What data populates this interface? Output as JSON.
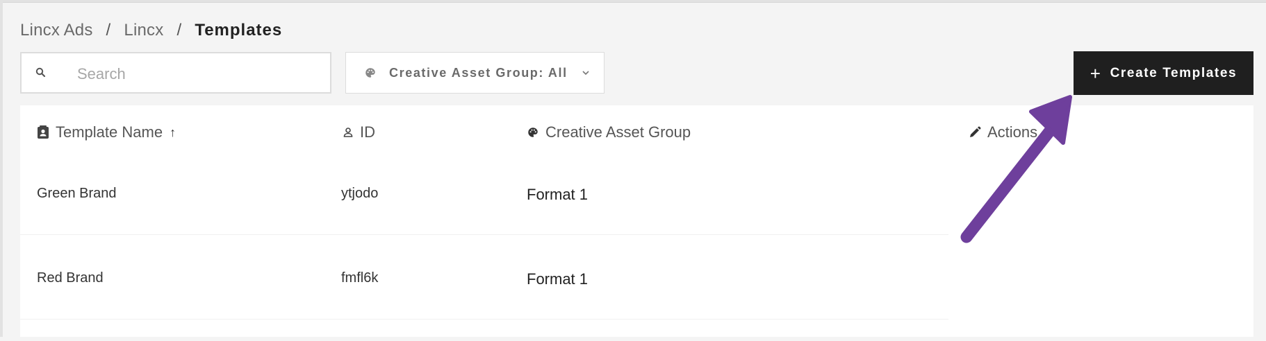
{
  "breadcrumb": {
    "items": [
      "Lincx Ads",
      "Lincx"
    ],
    "separator": "/",
    "current": "Templates"
  },
  "search": {
    "placeholder": "Search",
    "value": "",
    "icon": "search-icon"
  },
  "filter": {
    "label": "Creative Asset Group: All",
    "icon": "palette-icon"
  },
  "create_button": {
    "label": "Create Templates",
    "icon": "plus-icon"
  },
  "table": {
    "columns": [
      {
        "label": "Template Name",
        "icon": "contact-card-icon",
        "sort": "ascending"
      },
      {
        "label": "ID",
        "icon": "person-icon"
      },
      {
        "label": "Creative Asset Group",
        "icon": "palette-icon"
      },
      {
        "label": "Actions",
        "icon": "pencil-icon"
      }
    ],
    "rows": [
      {
        "name": "Green Brand",
        "id": "ytjodo",
        "group": "Format 1"
      },
      {
        "name": "Red Brand",
        "id": "fmfl6k",
        "group": "Format 1"
      }
    ]
  },
  "annotation": {
    "arrow_color": "#6e3f9c"
  },
  "colors": {
    "button_bg": "#1f1f1f",
    "page_bg": "#f4f4f4"
  }
}
